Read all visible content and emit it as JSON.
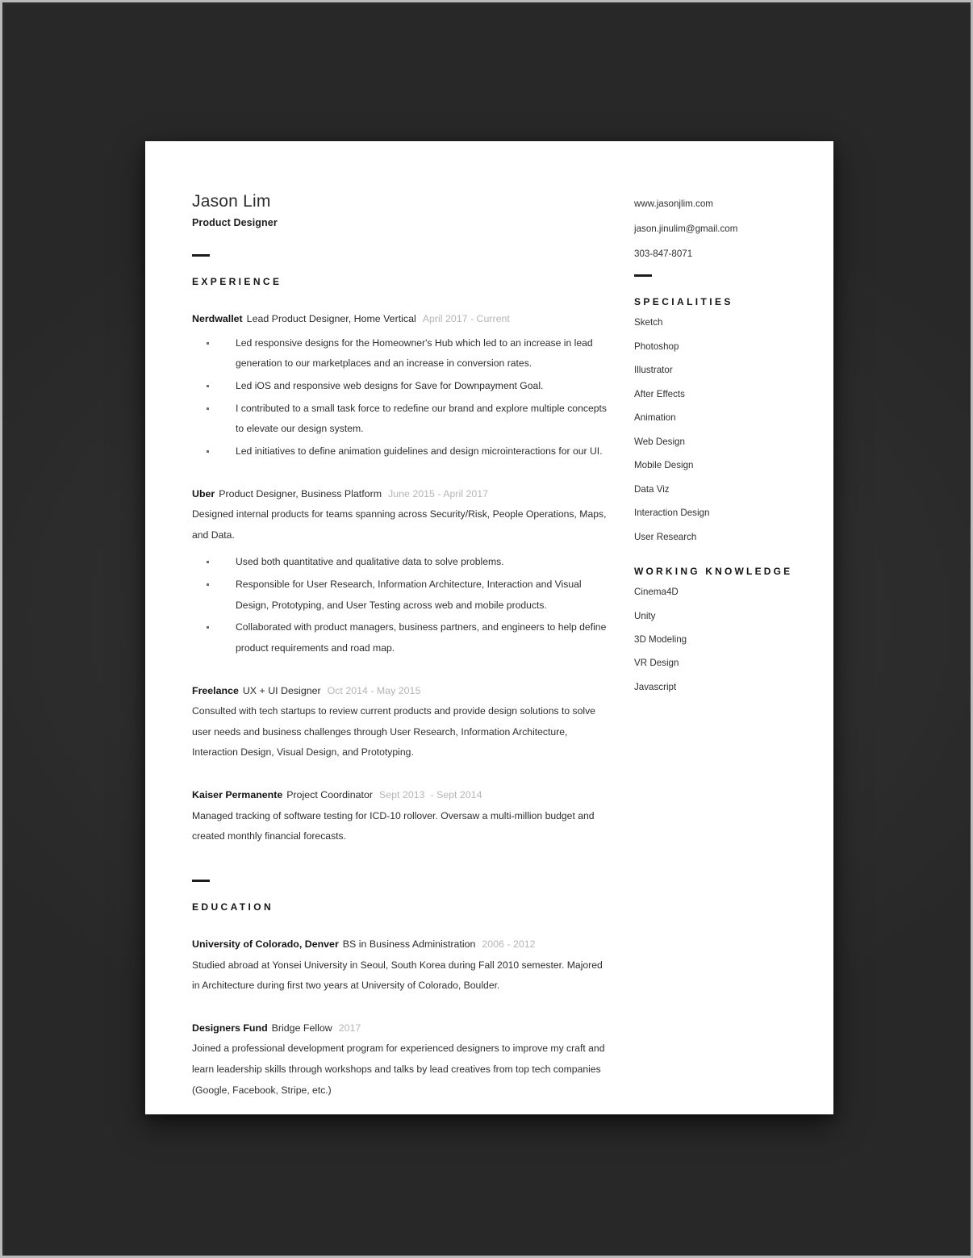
{
  "header": {
    "name": "Jason Lim",
    "role": "Product Designer"
  },
  "contact": {
    "website": "www.jasonjlim.com",
    "email": "jason.jinulim@gmail.com",
    "phone": "303-847-8071"
  },
  "sections": {
    "experience_heading": "EXPERIENCE",
    "education_heading": "EDUCATION",
    "specialities_heading": "SPECIALITIES",
    "working_knowledge_heading": "WORKING  KNOWLEDGE"
  },
  "experience": [
    {
      "org": "Nerdwallet",
      "title": "Lead Product Designer, Home Vertical",
      "dates": "April 2017 - Current",
      "desc": "",
      "bullets": [
        "Led responsive designs for the Homeowner's Hub which led to an increase in lead generation to our marketplaces and an increase in conversion rates.",
        "Led iOS and responsive web designs for Save for Downpayment Goal.",
        "I contributed to a small task force to redefine our brand and explore multiple concepts to elevate our design system.",
        "Led initiatives to define animation guidelines and design microinteractions for our UI."
      ]
    },
    {
      "org": "Uber",
      "title": "Product Designer, Business Platform",
      "dates": "June 2015 - April 2017",
      "desc": "Designed internal products for teams spanning across Security/Risk, People Operations, Maps, and Data.",
      "bullets": [
        "Used both quantitative and qualitative data to solve problems.",
        "Responsible for User Research, Information Architecture, Interaction and Visual Design, Prototyping, and User Testing across web and mobile products.",
        "Collaborated with product managers, business partners, and engineers to help define product requirements and road map."
      ]
    },
    {
      "org": "Freelance",
      "title": "UX + UI Designer",
      "dates": "Oct 2014 - May 2015",
      "desc": "Consulted with tech startups to review current products and provide design solutions to solve user needs and business challenges through User Research, Information Architecture, Interaction Design, Visual Design, and Prototyping.",
      "bullets": []
    },
    {
      "org": "Kaiser Permanente",
      "title": "Project Coordinator",
      "dates": "Sept 2013  - Sept 2014",
      "desc": "Managed tracking of software testing for ICD-10 rollover. Oversaw a multi-million budget and created monthly financial forecasts.",
      "bullets": []
    }
  ],
  "education": [
    {
      "org": "University of Colorado, Denver",
      "title": "BS in Business Administration",
      "dates": "2006 - 2012",
      "desc": "Studied abroad at Yonsei University in Seoul, South Korea during Fall 2010 semester. Majored in Architecture during first two years at University of Colorado, Boulder."
    },
    {
      "org": "Designers Fund",
      "title": "Bridge Fellow",
      "dates": "2017",
      "desc": "Joined a professional development program for experienced designers to improve my craft and learn leadership skills through workshops and talks by lead creatives from top tech companies (Google, Facebook, Stripe, etc.)"
    }
  ],
  "specialities": [
    "Sketch",
    "Photoshop",
    "Illustrator",
    "After Effects",
    "Animation",
    "Web Design",
    "Mobile Design",
    "Data Viz",
    "Interaction Design",
    "User Research"
  ],
  "working_knowledge": [
    "Cinema4D",
    "Unity",
    "3D Modeling",
    "VR Design",
    "Javascript"
  ],
  "colors": {
    "page_background": "#ffffff",
    "canvas_background": "#2b2b2b",
    "text": "#2b2b2b",
    "heading": "#141414",
    "date_muted": "#b5b5b5"
  }
}
